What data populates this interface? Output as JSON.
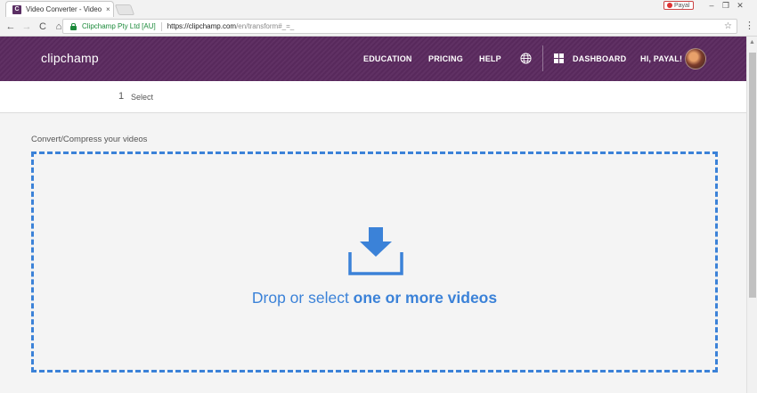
{
  "browser": {
    "tab_title": "Video Converter - Video",
    "tab_close": "×",
    "favicon_letter": "C",
    "profile_name": "Payal",
    "win_min": "–",
    "win_max": "❐",
    "win_close": "✕",
    "back": "←",
    "forward": "→",
    "reload": "C",
    "home": "⌂",
    "site_identity": "Clipchamp Pty Ltd [AU]",
    "url_host": "https://clipchamp.com",
    "url_path": "/en/transform#_=_",
    "star": "☆",
    "menu": "⋮"
  },
  "header": {
    "logo": "clipchamp",
    "nav": {
      "education": "EDUCATION",
      "pricing": "PRICING",
      "help": "HELP",
      "dashboard": "DASHBOARD",
      "user": "HI, PAYAL!"
    },
    "colors": {
      "brand": "#5b2a5f",
      "text": "#ffffff"
    }
  },
  "steps": {
    "current_number": "1",
    "current_label": "Select"
  },
  "main": {
    "section_title": "Convert/Compress your videos",
    "drop_text_prefix": "Drop or select ",
    "drop_text_bold": "one or more videos",
    "accent_color": "#3b82d8",
    "icon": "download-icon"
  }
}
